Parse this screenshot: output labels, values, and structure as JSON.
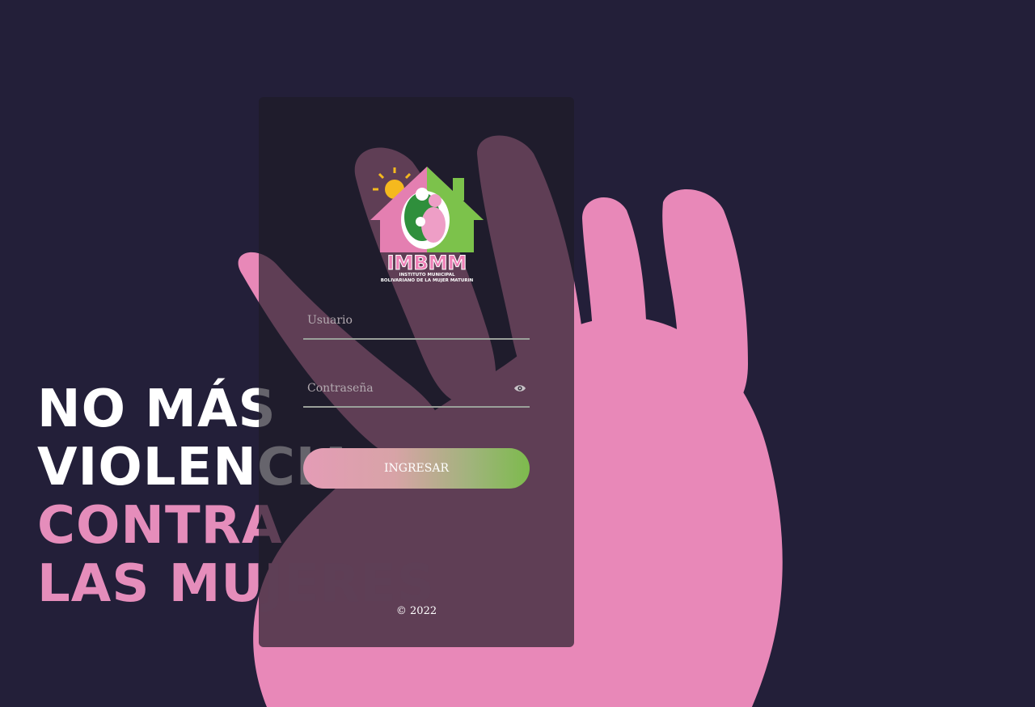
{
  "background": {
    "color": "#231f39",
    "hand_color": "#e888b8"
  },
  "slogan": {
    "line1": "NO MÁS",
    "line2": "VIOLENCIA",
    "line3": "CONTRA",
    "line4": "LAS MUJERES"
  },
  "logo": {
    "acronym": "IMBMM",
    "caption_line1": "INSTITUTO MUNICIPAL",
    "caption_line2": "BOLIVARIANO DE LA MUJER MATURIN"
  },
  "form": {
    "user_placeholder": "Usuario",
    "password_placeholder": "Contraseña",
    "password_toggle_icon": "eye-icon",
    "submit_label": "INGRESAR",
    "button_gradient": [
      "#e49cb6",
      "#7dba4d"
    ]
  },
  "footer": {
    "copyright": "© 2022"
  }
}
